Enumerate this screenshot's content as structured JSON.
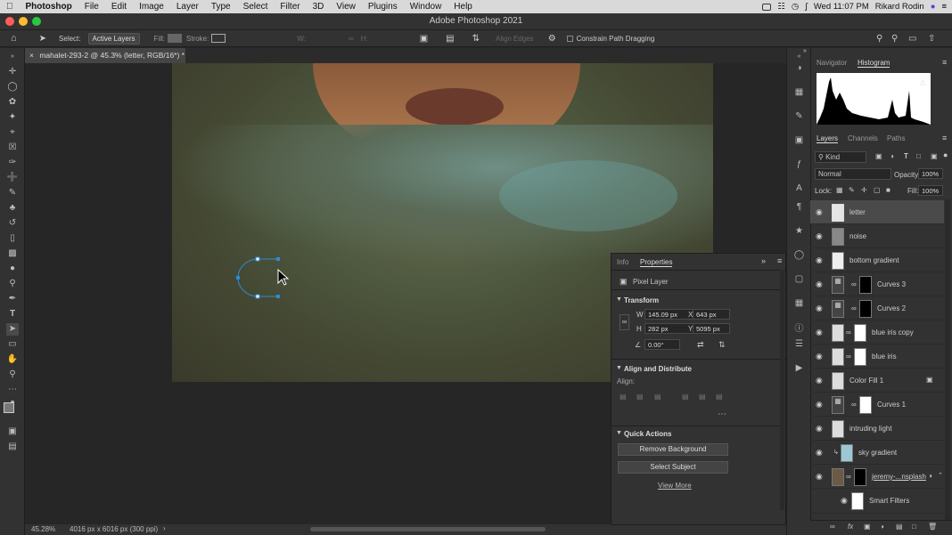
{
  "menubar": {
    "apple_icon": "apple-icon",
    "app_name": "Photoshop",
    "items": [
      "File",
      "Edit",
      "Image",
      "Layer",
      "Type",
      "Select",
      "Filter",
      "3D",
      "View",
      "Plugins",
      "Window",
      "Help"
    ],
    "datetime": "Wed 11:07 PM",
    "user": "Rikard Rodin"
  },
  "window": {
    "title": "Adobe Photoshop 2021"
  },
  "options": {
    "select_label": "Select:",
    "select_value": "Active Layers",
    "fill_label": "Fill:",
    "stroke_label": "Stroke:",
    "w_label": "W:",
    "h_label": "H:",
    "align_edges": "Align Edges",
    "constrain": "Constrain Path Dragging"
  },
  "document": {
    "tab_label": "mahalet-293-2 @ 45.3% (letter, RGB/16*) *",
    "zoom": "45.28%",
    "doc_info": "4016 px x 6016 px (300 ppi)"
  },
  "navigator_tabs": [
    "Navigator",
    "Histogram"
  ],
  "layers_tabs": [
    "Layers",
    "Channels",
    "Paths"
  ],
  "layers_controls": {
    "kind": "Kind",
    "blend": "Normal",
    "opacity_label": "Opacity:",
    "opacity": "100%",
    "lock_label": "Lock:",
    "fill_label": "Fill:",
    "fill": "100%"
  },
  "layers": [
    {
      "name": "letter"
    },
    {
      "name": "noise"
    },
    {
      "name": "bottom gradient"
    },
    {
      "name": "Curves 3"
    },
    {
      "name": "Curves 2"
    },
    {
      "name": "blue iris copy"
    },
    {
      "name": "blue iris"
    },
    {
      "name": "Color Fill 1"
    },
    {
      "name": "Curves 1"
    },
    {
      "name": "intruding light"
    },
    {
      "name": "sky gradient"
    },
    {
      "name": "jeremy-...nsplash"
    },
    {
      "name": "Smart Filters"
    }
  ],
  "properties": {
    "tabs": [
      "Info",
      "Properties"
    ],
    "layer_type": "Pixel Layer",
    "transform_title": "Transform",
    "w": "145.09 px",
    "h": "282 px",
    "x": "643 px",
    "y": "5095 px",
    "angle": "0.00°",
    "align_title": "Align and Distribute",
    "align_label": "Align:",
    "quick_title": "Quick Actions",
    "remove_bg": "Remove Background",
    "select_subject": "Select Subject",
    "view_more": "View More"
  }
}
